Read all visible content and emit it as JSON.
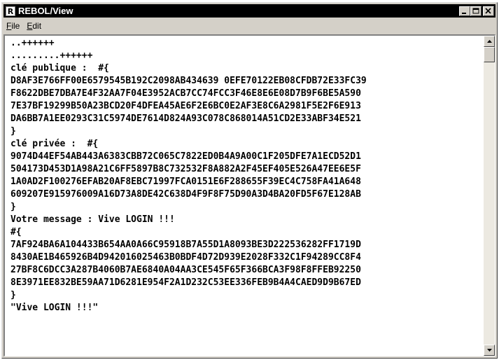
{
  "window": {
    "title": "REBOL/View",
    "app_icon_letter": "R",
    "icon": "rebol-app-icon",
    "buttons": [
      {
        "name": "minimize",
        "icon": "minimize-icon"
      },
      {
        "name": "maximize",
        "icon": "maximize-icon"
      },
      {
        "name": "close",
        "icon": "close-icon"
      }
    ],
    "colors": {
      "titlebar": "#000000",
      "title_text": "#ffffff",
      "chrome": "#d4d0c8",
      "content": "#ffffff"
    }
  },
  "menu": {
    "file": {
      "mnemonic": "F",
      "rest": "ile"
    },
    "edit": {
      "mnemonic": "E",
      "rest": "dit"
    }
  },
  "content": {
    "lines": [
      "..++++++",
      ".........++++++",
      "clé publique :  #{",
      "D8AF3E766FF00E6579545B192C2098AB434639 0EFE70122EB08CFDB72E33FC39",
      "F8622DBE7DBA7E4F32AA7F04E3952ACB7CC74FCC3F46E8E6E08D7B9F6BE5A590",
      "7E37BF19299B50A23BCD20F4DFEA45AE6F2E6BC0E2AF3E8C6A2981F5E2F6E913",
      "DA6BB7A1EE0293C31C5974DE7614D824A93C078C868014A51CD2E33ABF34E521",
      "}",
      "clé privée :  #{",
      "9074D44EF54AB443A6383CBB72C065C7822ED0B4A9A00C1F205DFE7A1ECD52D1",
      "504173D453D1A98A21C6FF5897B8C732532F8A882A2F45EF405E526A47EE6E5F",
      "1A0AD2F100276EFAB20AF8EBC71997FCA0151E6F288655F39EC4C758FA41A648",
      "609207E915976009A16D73A8DE42C638D4F9F8F75D90A3D4BA20FD5F67E128AB",
      "}",
      "Votre message : Vive LOGIN !!!",
      "#{",
      "7AF924BA6A104433B654AA0A66C95918B7A55D1A8093BE3D222536282FF1719D",
      "8430AE1B465926B4D942016025463B0BDF4D72D939E2028F332C1F94289CC8F4",
      "27BF8C6DCC3A287B4060B7AE6840A04AA3CE545F65F366BCA3F98F8FFEB92250",
      "8E3971EE832BE59AA71D6281E954F2A1D232C53EE336FEB9B4A4CAED9D9B67ED",
      "}",
      "\"Vive LOGIN !!!\""
    ]
  },
  "scrollbar": {
    "up_icon": "scroll-up-arrow-icon",
    "down_icon": "scroll-down-arrow-icon"
  }
}
